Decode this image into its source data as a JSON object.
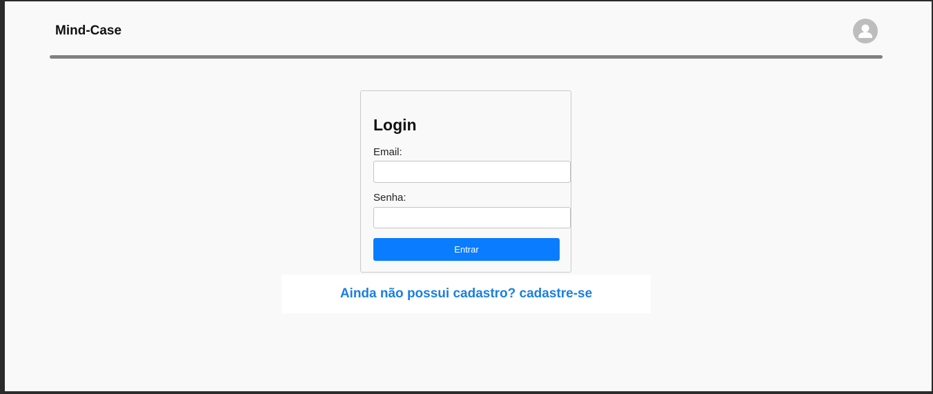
{
  "header": {
    "brand": "Mind-Case",
    "avatar_icon": "user-avatar-icon"
  },
  "login": {
    "title": "Login",
    "email_label": "Email:",
    "email_value": "",
    "password_label": "Senha:",
    "password_value": "",
    "submit_label": "Entrar"
  },
  "signup": {
    "link_text": "Ainda não possui cadastro? cadastre-se"
  },
  "colors": {
    "accent": "#0a7cff",
    "link": "#1a7fe0",
    "divider": "#808080",
    "avatar_bg": "#bdbdbd"
  }
}
